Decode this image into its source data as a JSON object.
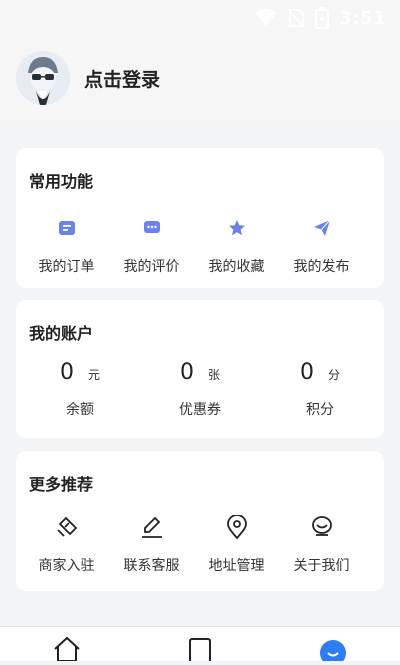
{
  "status": {
    "time": "3:51"
  },
  "header": {
    "login_label": "点击登录"
  },
  "functions": {
    "title": "常用功能",
    "items": [
      {
        "label": "我的订单",
        "icon": "order-icon"
      },
      {
        "label": "我的评价",
        "icon": "comment-icon"
      },
      {
        "label": "我的收藏",
        "icon": "star-icon"
      },
      {
        "label": "我的发布",
        "icon": "send-icon"
      }
    ]
  },
  "account": {
    "title": "我的账户",
    "items": [
      {
        "value": "0",
        "unit": "元",
        "label": "余额"
      },
      {
        "value": "0",
        "unit": "张",
        "label": "优惠券"
      },
      {
        "value": "0",
        "unit": "分",
        "label": "积分"
      }
    ]
  },
  "more": {
    "title": "更多推荐",
    "items": [
      {
        "label": "商家入驻",
        "icon": "merchant-icon"
      },
      {
        "label": "联系客服",
        "icon": "edit-icon"
      },
      {
        "label": "地址管理",
        "icon": "location-icon"
      },
      {
        "label": "关于我们",
        "icon": "smile-icon"
      }
    ]
  },
  "tabbar": {
    "items": [
      {
        "icon": "home-icon"
      },
      {
        "icon": "square-icon"
      },
      {
        "icon": "profile-icon"
      }
    ]
  },
  "colors": {
    "accent": "#6b82e8",
    "tab_active": "#2f7df6"
  }
}
